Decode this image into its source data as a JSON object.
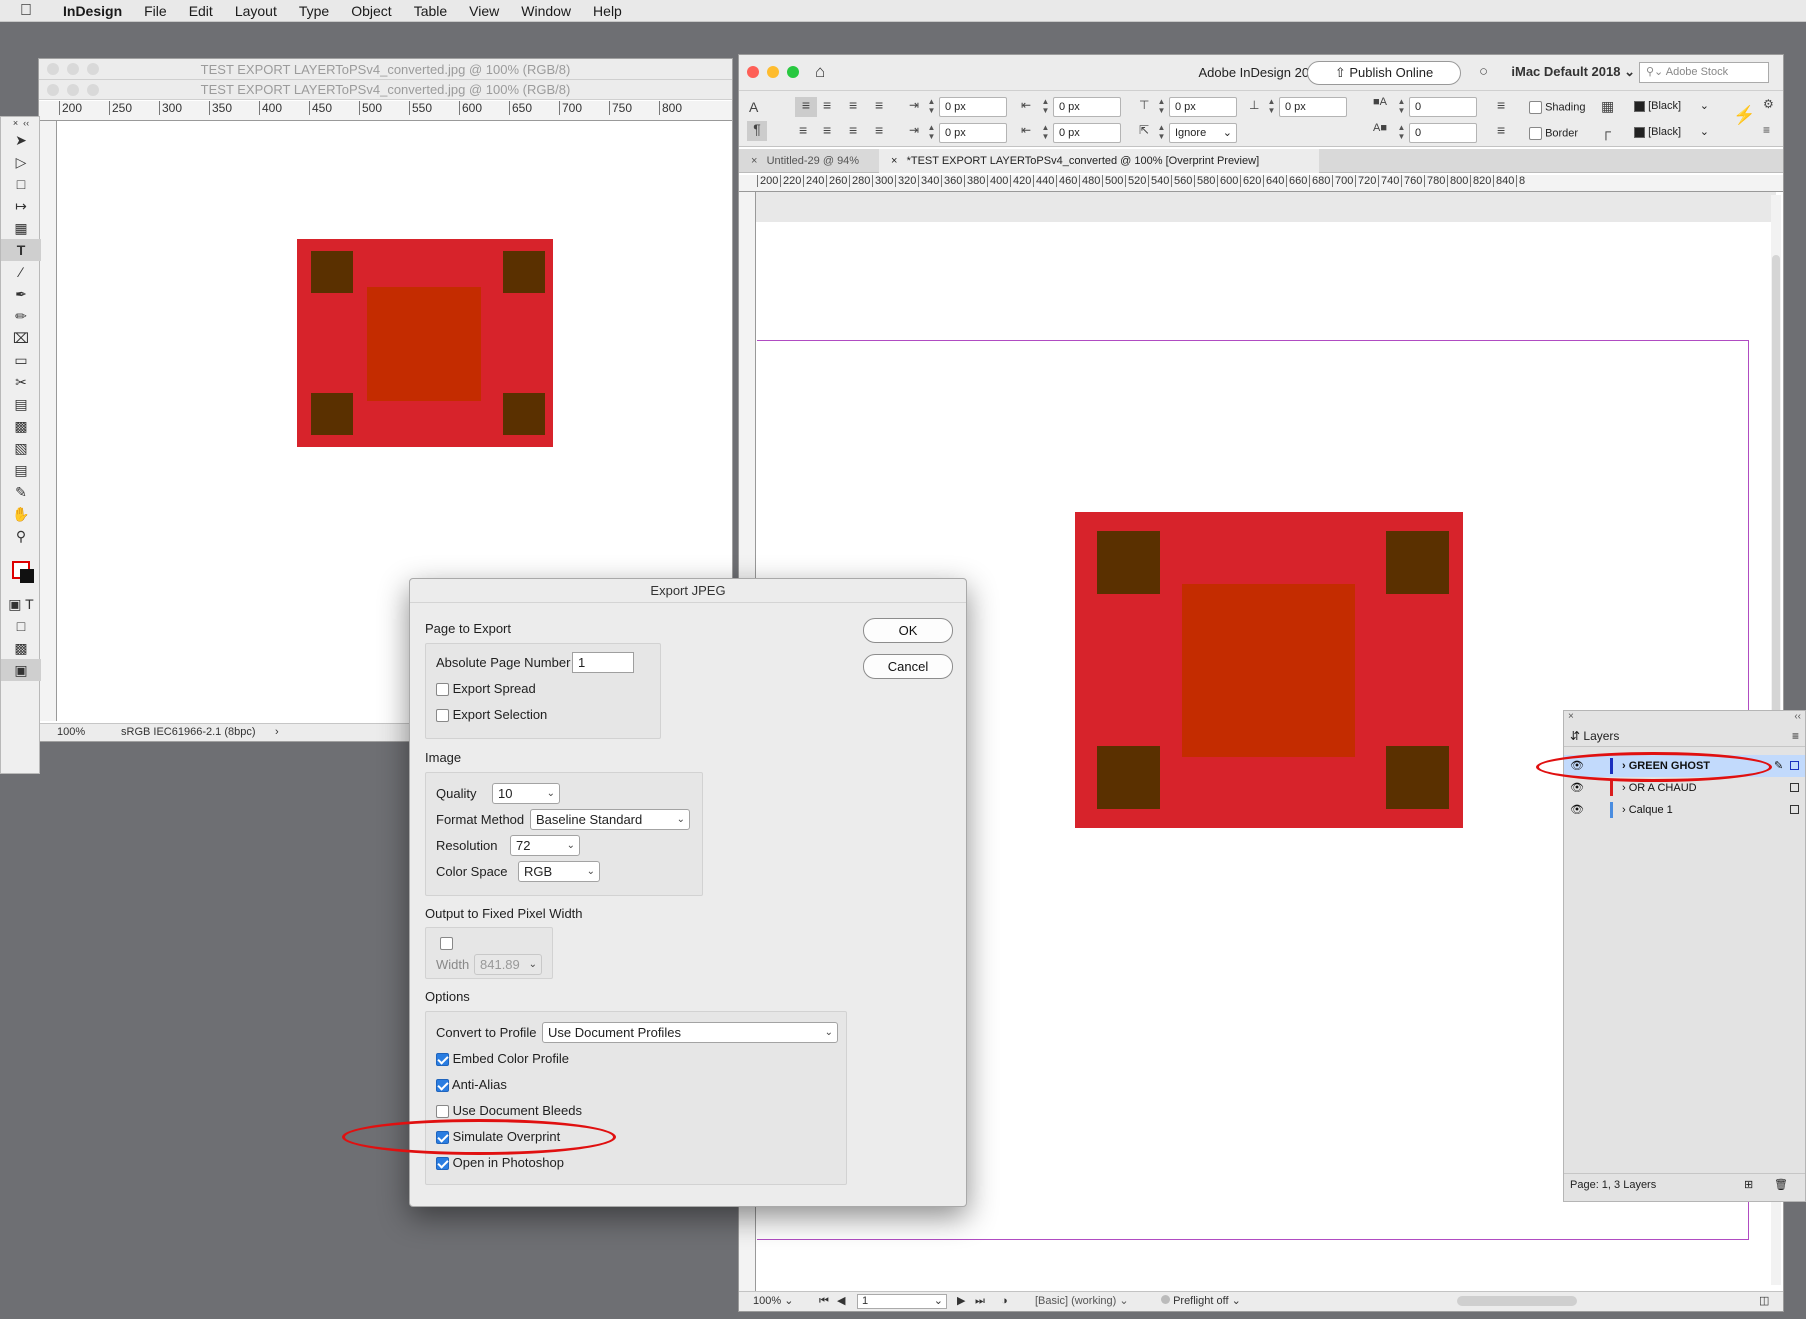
{
  "menubar": {
    "app": "InDesign",
    "items": [
      "File",
      "Edit",
      "Layout",
      "Type",
      "Object",
      "Table",
      "View",
      "Window",
      "Help"
    ]
  },
  "photoshop": {
    "title1": "TEST EXPORT LAYERToPSv4_converted.jpg @ 100% (RGB/8)",
    "title2": "TEST EXPORT LAYERToPSv4_converted.jpg @ 100% (RGB/8)",
    "ruler_ticks": [
      "200",
      "250",
      "300",
      "350",
      "400",
      "450",
      "500",
      "550",
      "600",
      "650",
      "700",
      "750",
      "800"
    ],
    "zoom": "100%",
    "profile": "sRGB IEC61966-2.1 (8bpc)"
  },
  "indesign": {
    "title": "Adobe InDesign 2020",
    "publish": "Publish Online",
    "workspace": "iMac Default 2018",
    "stock_placeholder": "Adobe Stock",
    "tab1": "Untitled-29 @ 94%",
    "tab2": "*TEST EXPORT LAYERToPSv4_converted @ 100% [Overprint Preview]",
    "ruler_ticks": [
      "200",
      "220",
      "240",
      "260",
      "280",
      "300",
      "320",
      "340",
      "360",
      "380",
      "400",
      "420",
      "440",
      "460",
      "480",
      "500",
      "520",
      "540",
      "560",
      "580",
      "600",
      "620",
      "640",
      "660",
      "680",
      "700",
      "720",
      "740",
      "760",
      "780",
      "800",
      "820",
      "840",
      "8"
    ],
    "fields": {
      "indent_left": "0 px",
      "indent_right": "0 px",
      "first_line": "0 px",
      "last_line": "0 px",
      "space_before": "0 px",
      "space_after": "0 px",
      "drop_cap_lines": "0",
      "drop_cap_chars": "0",
      "align_grid": "Ignore"
    },
    "shading_label": "Shading",
    "border_label": "Border",
    "swatch1": "[Black]",
    "swatch2": "[Black]",
    "status": {
      "zoom": "100%",
      "page": "1",
      "style": "[Basic] (working)",
      "preflight": "Preflight off"
    }
  },
  "dialog": {
    "title": "Export JPEG",
    "ok": "OK",
    "cancel": "Cancel",
    "page_section": "Page to Export",
    "abs_page_label": "Absolute Page Number",
    "abs_page_value": "1",
    "export_spread": "Export Spread",
    "export_selection": "Export Selection",
    "image_section": "Image",
    "quality_label": "Quality",
    "quality_value": "10",
    "format_label": "Format Method",
    "format_value": "Baseline Standard",
    "resolution_label": "Resolution",
    "resolution_value": "72",
    "colorspace_label": "Color Space",
    "colorspace_value": "RGB",
    "fixed_section": "Output to Fixed Pixel Width",
    "width_label": "Width",
    "width_value": "841.89",
    "options_section": "Options",
    "convert_label": "Convert to Profile",
    "convert_value": "Use Document Profiles",
    "embed": "Embed Color Profile",
    "antialias": "Anti-Alias",
    "bleeds": "Use Document Bleeds",
    "simulate": "Simulate Overprint",
    "open_ps": "Open in Photoshop"
  },
  "layers": {
    "title": "Layers",
    "items": [
      {
        "name": "GREEN GHOST",
        "color": "#1a2fbf"
      },
      {
        "name": "OR A CHAUD",
        "color": "#d91d1d"
      },
      {
        "name": "Calque 1",
        "color": "#4a8de0"
      }
    ],
    "footer": "Page: 1, 3 Layers"
  },
  "colors": {
    "artwork_red": "#d7232b",
    "artwork_brown": "#5a3000",
    "artwork_center": "#c42c00",
    "accent_red": "#e01010"
  }
}
